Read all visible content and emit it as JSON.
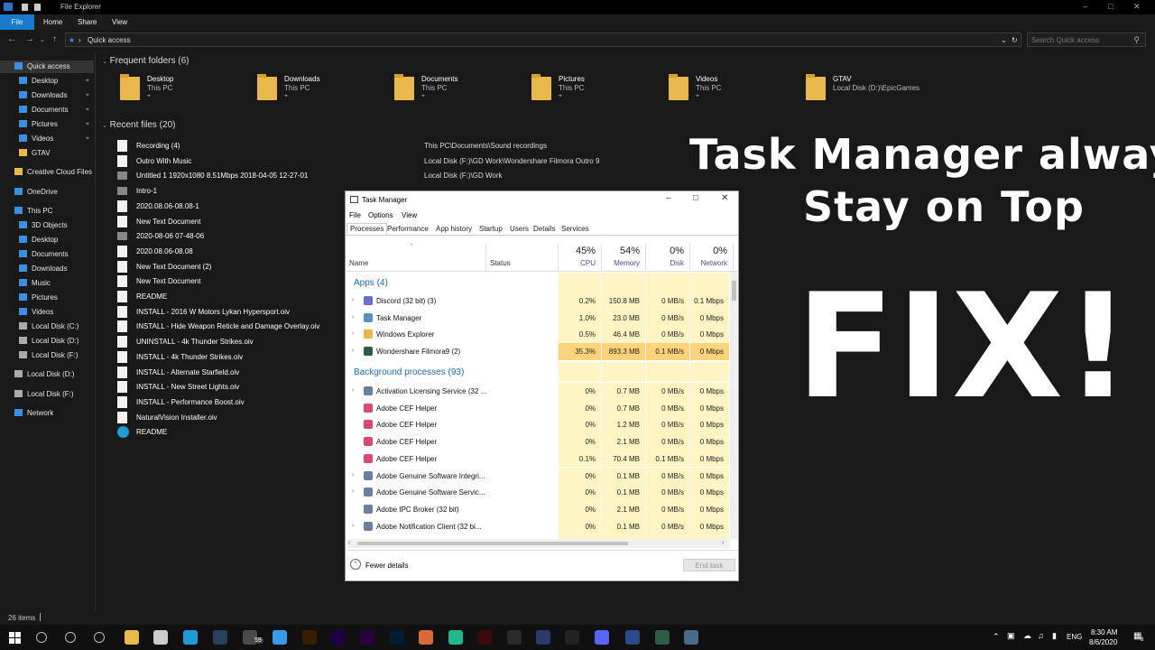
{
  "explorer": {
    "title": "File Explorer",
    "ribbon_tabs": [
      "File",
      "Home",
      "Share",
      "View"
    ],
    "address": "Quick access",
    "search_placeholder": "Search Quick access",
    "status": "26 items",
    "sidebar": [
      {
        "label": "Quick access",
        "icon": "star-icon",
        "color": "#3c8fe0"
      },
      {
        "label": "Desktop",
        "icon": "desktop-icon",
        "color": "#3c8fe0",
        "pinned": true
      },
      {
        "label": "Downloads",
        "icon": "downloads-icon",
        "color": "#3c8fe0",
        "pinned": true
      },
      {
        "label": "Documents",
        "icon": "documents-icon",
        "color": "#3c8fe0",
        "pinned": true
      },
      {
        "label": "Pictures",
        "icon": "pictures-icon",
        "color": "#3c8fe0",
        "pinned": true
      },
      {
        "label": "Videos",
        "icon": "videos-icon",
        "color": "#3c8fe0",
        "pinned": true
      },
      {
        "label": "GTAV",
        "icon": "folder-icon",
        "color": "#e9b84a"
      },
      {
        "label": "Creative Cloud Files",
        "icon": "creative-cloud-icon",
        "color": "#e9b84a"
      },
      {
        "label": "OneDrive",
        "icon": "onedrive-icon",
        "color": "#3c8fe0"
      },
      {
        "label": "This PC",
        "icon": "pc-icon",
        "color": "#3c8fe0"
      },
      {
        "label": "3D Objects",
        "icon": "3d-icon",
        "color": "#3c8fe0"
      },
      {
        "label": "Desktop",
        "icon": "desktop-icon",
        "color": "#3c8fe0"
      },
      {
        "label": "Documents",
        "icon": "documents-icon",
        "color": "#3c8fe0"
      },
      {
        "label": "Downloads",
        "icon": "downloads-icon",
        "color": "#3c8fe0"
      },
      {
        "label": "Music",
        "icon": "music-icon",
        "color": "#3c8fe0"
      },
      {
        "label": "Pictures",
        "icon": "pictures-icon",
        "color": "#3c8fe0"
      },
      {
        "label": "Videos",
        "icon": "videos-icon",
        "color": "#3c8fe0"
      },
      {
        "label": "Local Disk (C:)",
        "icon": "drive-icon",
        "color": "#aaaaaa"
      },
      {
        "label": "Local Disk (D:)",
        "icon": "drive-icon",
        "color": "#aaaaaa"
      },
      {
        "label": "Local Disk (F:)",
        "icon": "drive-icon",
        "color": "#aaaaaa"
      },
      {
        "label": "Local Disk (D:)",
        "icon": "drive-icon",
        "color": "#aaaaaa"
      },
      {
        "label": "Local Disk (F:)",
        "icon": "drive-icon",
        "color": "#aaaaaa"
      },
      {
        "label": "Network",
        "icon": "network-icon",
        "color": "#3c8fe0"
      }
    ],
    "frequent_title": "Frequent folders (6)",
    "frequent": [
      {
        "name": "Desktop",
        "sub": "This PC"
      },
      {
        "name": "Downloads",
        "sub": "This PC"
      },
      {
        "name": "Documents",
        "sub": "This PC"
      },
      {
        "name": "Pictures",
        "sub": "This PC"
      },
      {
        "name": "Videos",
        "sub": "This PC"
      },
      {
        "name": "GTAV",
        "sub": "Local Disk (D:)\\EpicGames"
      }
    ],
    "recent_title": "Recent files (20)",
    "recent": [
      {
        "name": "Recording (4)",
        "loc": "This PC\\Documents\\Sound recordings"
      },
      {
        "name": "Outro With Music",
        "loc": "Local Disk (F:)\\GD Work\\Wondershare Filmora Outro 9"
      },
      {
        "name": "Untitled 1 1920x1080 8.51Mbps 2018-04-05 12-27-01",
        "loc": "Local Disk (F:)\\GD Work"
      },
      {
        "name": "Intro-1",
        "loc": ""
      },
      {
        "name": "2020.08.06-08.08-1",
        "loc": ""
      },
      {
        "name": "New Text Document",
        "loc": ""
      },
      {
        "name": "2020-08-06 07-48-06",
        "loc": ""
      },
      {
        "name": "2020.08.06-08.08",
        "loc": ""
      },
      {
        "name": "New Text Document (2)",
        "loc": ""
      },
      {
        "name": "New Text Document",
        "loc": ""
      },
      {
        "name": "README",
        "loc": ""
      },
      {
        "name": "INSTALL - 2016 W Motors Lykan Hypersport.oiv",
        "loc": ""
      },
      {
        "name": "INSTALL - Hide Weapon Reticle and Damage Overlay.oiv",
        "loc": ""
      },
      {
        "name": "UNINSTALL - 4k Thunder Strikes.oiv",
        "loc": ""
      },
      {
        "name": "INSTALL - 4k Thunder Strikes.oiv",
        "loc": ""
      },
      {
        "name": "INSTALL - Alternate Starfield.oiv",
        "loc": ""
      },
      {
        "name": "INSTALL - New Street Lights.oiv",
        "loc": ""
      },
      {
        "name": "INSTALL - Performance Boost.oiv",
        "loc": ""
      },
      {
        "name": "NaturalVision Installer.oiv",
        "loc": ""
      },
      {
        "name": "README",
        "loc": ""
      }
    ]
  },
  "overlay": {
    "line1": "Task Manager always",
    "line2": "Stay on Top",
    "fix": "FIX!"
  },
  "taskmgr": {
    "title": "Task Manager",
    "menu": [
      "File",
      "Options",
      "View"
    ],
    "tabs": [
      "Processes",
      "Performance",
      "App history",
      "Startup",
      "Users",
      "Details",
      "Services"
    ],
    "headers": {
      "name": "Name",
      "status": "Status",
      "cpu_pct": "45%",
      "cpu": "CPU",
      "mem_pct": "54%",
      "mem": "Memory",
      "disk_pct": "0%",
      "disk": "Disk",
      "net_pct": "0%",
      "net": "Network"
    },
    "apps_group": "Apps (4)",
    "bg_group": "Background processes (93)",
    "apps": [
      {
        "name": "Discord (32 bit) (3)",
        "cpu": "0.2%",
        "mem": "150.8 MB",
        "disk": "0 MB/s",
        "net": "0.1 Mbps",
        "icon": "discord-icon",
        "color": "#6b6bd6",
        "hot": false
      },
      {
        "name": "Task Manager",
        "cpu": "1.0%",
        "mem": "23.0 MB",
        "disk": "0 MB/s",
        "net": "0 Mbps",
        "icon": "taskmanager-icon",
        "color": "#5f8fbf",
        "hot": false
      },
      {
        "name": "Windows Explorer",
        "cpu": "0.5%",
        "mem": "46.4 MB",
        "disk": "0 MB/s",
        "net": "0 Mbps",
        "icon": "explorer-icon",
        "color": "#e9b84a",
        "hot": false
      },
      {
        "name": "Wondershare Filmora9 (2)",
        "cpu": "35.3%",
        "mem": "893.3 MB",
        "disk": "0.1 MB/s",
        "net": "0 Mbps",
        "icon": "filmora-icon",
        "color": "#2b5c46",
        "hot": true
      }
    ],
    "background": [
      {
        "name": "Activation Licensing Service (32 ...",
        "cpu": "0%",
        "mem": "0.7 MB",
        "disk": "0 MB/s",
        "net": "0 Mbps",
        "icon": "service-icon",
        "color": "#6a7fa0",
        "chev": true
      },
      {
        "name": "Adobe CEF Helper",
        "cpu": "0%",
        "mem": "0.7 MB",
        "disk": "0 MB/s",
        "net": "0 Mbps",
        "icon": "adobe-cef-icon",
        "color": "#d94a6a",
        "chev": false
      },
      {
        "name": "Adobe CEF Helper",
        "cpu": "0%",
        "mem": "1.2 MB",
        "disk": "0 MB/s",
        "net": "0 Mbps",
        "icon": "adobe-cef-icon",
        "color": "#d94a6a",
        "chev": false
      },
      {
        "name": "Adobe CEF Helper",
        "cpu": "0%",
        "mem": "2.1 MB",
        "disk": "0 MB/s",
        "net": "0 Mbps",
        "icon": "adobe-cef-icon",
        "color": "#d94a6a",
        "chev": false
      },
      {
        "name": "Adobe CEF Helper",
        "cpu": "0.1%",
        "mem": "70.4 MB",
        "disk": "0.1 MB/s",
        "net": "0 Mbps",
        "icon": "adobe-cef-icon",
        "color": "#d94a6a",
        "chev": false
      },
      {
        "name": "Adobe Genuine Software Integri...",
        "cpu": "0%",
        "mem": "0.1 MB",
        "disk": "0 MB/s",
        "net": "0 Mbps",
        "icon": "service-icon",
        "color": "#6a7fa0",
        "chev": true
      },
      {
        "name": "Adobe Genuine Software Servic...",
        "cpu": "0%",
        "mem": "0.1 MB",
        "disk": "0 MB/s",
        "net": "0 Mbps",
        "icon": "service-icon",
        "color": "#6a7fa0",
        "chev": true
      },
      {
        "name": "Adobe IPC Broker (32 bit)",
        "cpu": "0%",
        "mem": "2.1 MB",
        "disk": "0 MB/s",
        "net": "0 Mbps",
        "icon": "service-icon",
        "color": "#6a7fa0",
        "chev": false
      },
      {
        "name": "Adobe Notification Client (32 bi...",
        "cpu": "0%",
        "mem": "0.1 MB",
        "disk": "0 MB/s",
        "net": "0 Mbps",
        "icon": "service-icon",
        "color": "#6a7fa0",
        "chev": true
      }
    ],
    "fewer_details": "Fewer details",
    "end_task": "End task",
    "colors": {
      "cell": "#fff4c4",
      "cell_hot": "#ffd37a"
    }
  },
  "taskbar": {
    "time": "8:30 AM",
    "date": "8/6/2020",
    "lang": "ENG",
    "badge": "59",
    "notif": "8",
    "apps": [
      {
        "icon": "search-icon",
        "color": "#101010"
      },
      {
        "icon": "cortana-icon",
        "color": "#101010"
      },
      {
        "icon": "task-view-icon",
        "color": "#101010"
      },
      {
        "icon": "file-explorer-icon",
        "color": "#e9b84a"
      },
      {
        "icon": "store-icon",
        "color": "#cccccc"
      },
      {
        "icon": "edge-icon",
        "color": "#1e9bd7"
      },
      {
        "icon": "steam-icon",
        "color": "#2a3f5a"
      },
      {
        "icon": "chat-icon",
        "color": "#4a4a4a"
      },
      {
        "icon": "browser-icon",
        "color": "#3a9ae6"
      },
      {
        "icon": "illustrator-icon",
        "color": "#3a1d00"
      },
      {
        "icon": "after-effects-icon",
        "color": "#1f0040"
      },
      {
        "icon": "premiere-icon",
        "color": "#2a0040"
      },
      {
        "icon": "photoshop-icon",
        "color": "#001d34"
      },
      {
        "icon": "pen-icon",
        "color": "#d86a3a"
      },
      {
        "icon": "game-icon",
        "color": "#1fb88a"
      },
      {
        "icon": "media-icon",
        "color": "#3a0a0a"
      },
      {
        "icon": "xsplit-icon",
        "color": "#2a2a2a"
      },
      {
        "icon": "app-icon",
        "color": "#2a3a6a"
      },
      {
        "icon": "epic-icon",
        "color": "#222222"
      },
      {
        "icon": "discord-icon",
        "color": "#5865f2"
      },
      {
        "icon": "bluestacks-icon",
        "color": "#2a4a8a"
      },
      {
        "icon": "filmora-icon",
        "color": "#2b5c46"
      },
      {
        "icon": "taskmanager-icon",
        "color": "#4a6a8a"
      }
    ]
  }
}
